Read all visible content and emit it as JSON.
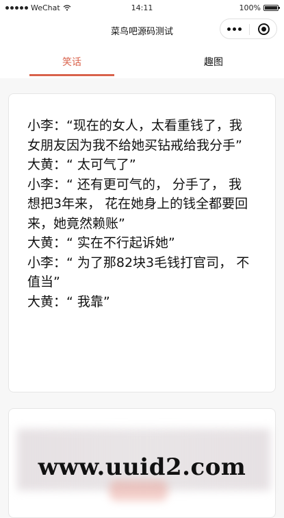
{
  "status_bar": {
    "carrier": "WeChat",
    "time": "14:11",
    "battery": "100%"
  },
  "nav_bar": {
    "title": "菜鸟吧源码测试"
  },
  "tabs": [
    {
      "label": "笑话",
      "active": true
    },
    {
      "label": "趣图",
      "active": false
    }
  ],
  "colors": {
    "accent": "#d9624b",
    "text": "#111111",
    "card_border": "#e6e6e6",
    "background": "#f7f7f7"
  },
  "joke_card": {
    "lines": [
      "小李：“现在的女人，太看重钱了，我",
      "女朋友因为我不给她买钻戒给我分手”",
      "大黄：“ 太可气了”",
      "小李：“ 还有更可气的， 分手了， 我",
      "想把3年来， 花在她身上的钱全都要回",
      "来，她竟然赖账”",
      "大黄：“ 实在不行起诉她”",
      "小李：“ 为了那82块3毛钱打官司， 不",
      "值当”",
      "大黄：“ 我靠”"
    ]
  },
  "watermark": "www.uuid2.com"
}
